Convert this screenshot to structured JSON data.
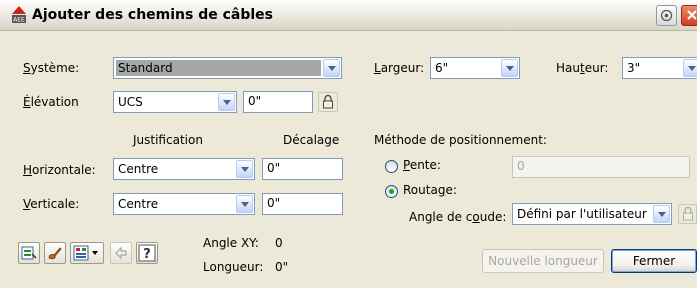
{
  "window": {
    "title": "Ajouter des chemins de câbles",
    "icon": "autocad-app-icon",
    "controls": [
      "help-icon",
      "close-icon"
    ]
  },
  "system": {
    "label": "Système:",
    "underline": "S",
    "rest": "ystème:",
    "value": "Standard"
  },
  "elevation": {
    "label": "Élévation",
    "underline": "É",
    "rest": "lévation",
    "mode": "UCS",
    "value": "0\""
  },
  "width": {
    "label": "Largeur:",
    "underline": "L",
    "rest": "argeur:",
    "value": "6\""
  },
  "height": {
    "label": "Hauteur:",
    "pre": "Hau",
    "underline": "t",
    "rest": "eur:",
    "value": "3\""
  },
  "justification_header": "Justification",
  "offset_header": "Décalage",
  "horizontal": {
    "pre": "",
    "underline": "H",
    "rest": "orizontale:",
    "value": "Centre",
    "offset": "0\""
  },
  "vertical": {
    "pre": "",
    "underline": "V",
    "rest": "erticale:",
    "value": "Centre",
    "offset": "0\""
  },
  "positioning": {
    "header": "Méthode de positionnement:",
    "slope": {
      "underline": "P",
      "rest": "ente:",
      "value": "0",
      "checked": false
    },
    "routing": {
      "pre": "Routa",
      "underline": "g",
      "rest": "e:",
      "checked": true
    },
    "bend_angle": {
      "pre": "Angle de c",
      "underline": "o",
      "rest": "ude:",
      "value": "Défini par l'utilisateur"
    }
  },
  "info": {
    "angle_xy_label": "Angle XY:",
    "angle_xy_value": "0",
    "length_label": "Longueur:",
    "length_value": "0\""
  },
  "toolbar": [
    "match-properties-icon",
    "paintbrush-icon",
    "pipe-tool-icon",
    "undo-icon",
    "help-icon"
  ],
  "buttons": {
    "new_length": "Nouvelle longueur",
    "close": "Fermer"
  },
  "colors": {
    "dialog_bg": "#ece9d8",
    "field_border": "#7f9db9",
    "radio_dot": "#21a121",
    "close_red": "#d0401e"
  }
}
